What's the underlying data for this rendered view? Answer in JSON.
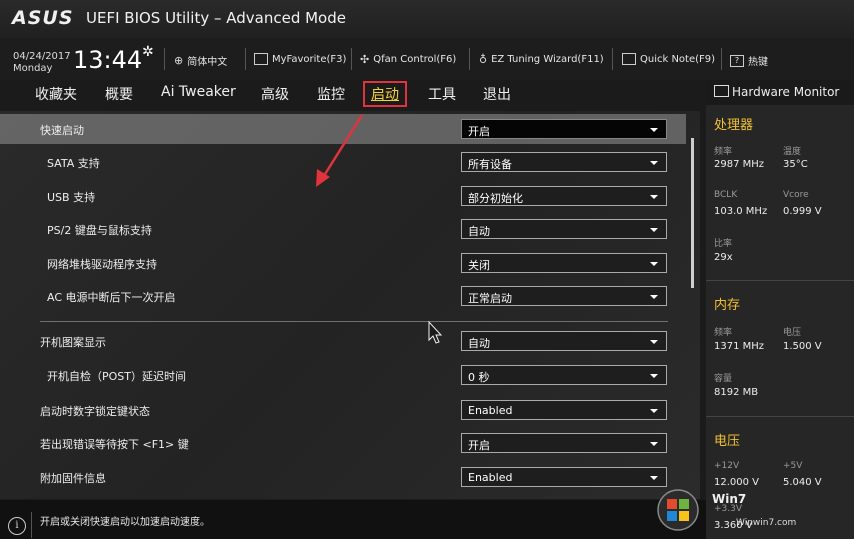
{
  "title_bar": {
    "brand": "ASUS",
    "title": "UEFI BIOS Utility – Advanced Mode"
  },
  "info_bar": {
    "date": "04/24/2017",
    "weekday": "Monday",
    "time": "13:44",
    "tools": [
      {
        "label": "简体中文",
        "icon": "globe-icon"
      },
      {
        "label": "MyFavorite(F3)",
        "icon": "favorite-icon"
      },
      {
        "label": "Qfan Control(F6)",
        "icon": "fan-icon"
      },
      {
        "label": "EZ Tuning Wizard(F11)",
        "icon": "bulb-icon"
      },
      {
        "label": "Quick Note(F9)",
        "icon": "note-icon"
      },
      {
        "label": "热键",
        "icon": "hotkey-icon"
      }
    ]
  },
  "tabs": [
    {
      "label": "收藏夹"
    },
    {
      "label": "概要"
    },
    {
      "label": "Ai Tweaker"
    },
    {
      "label": "高级"
    },
    {
      "label": "监控"
    },
    {
      "label": "启动",
      "active": true
    },
    {
      "label": "工具"
    },
    {
      "label": "退出"
    }
  ],
  "settings": [
    {
      "label": "快速启动",
      "value": "开启"
    },
    {
      "label": "SATA 支持",
      "value": "所有设备"
    },
    {
      "label": "USB 支持",
      "value": "部分初始化"
    },
    {
      "label": "PS/2 键盘与鼠标支持",
      "value": "自动"
    },
    {
      "label": "网络堆栈驱动程序支持",
      "value": "关闭"
    },
    {
      "label": "AC 电源中断后下一次开启",
      "value": "正常启动"
    },
    {
      "label": "开机图案显示",
      "value": "自动"
    },
    {
      "label": "开机自检（POST）延迟时间",
      "value": "0 秒"
    },
    {
      "label": "启动时数字锁定键状态",
      "value": "Enabled"
    },
    {
      "label": "若出现错误等待按下 <F1> 键",
      "value": "开启"
    },
    {
      "label": "附加固件信息",
      "value": "Enabled"
    }
  ],
  "help_text": "开启或关闭快速启动以加速启动速度。",
  "monitor": {
    "title": "Hardware Monitor",
    "cpu": {
      "title": "处理器",
      "freq_label": "频率",
      "freq": "2987 MHz",
      "temp_label": "温度",
      "temp": "35°C",
      "bclk_label": "BCLK",
      "bclk": "103.0 MHz",
      "vcore_label": "Vcore",
      "vcore": "0.999 V",
      "ratio_label": "比率",
      "ratio": "29x"
    },
    "memory": {
      "title": "内存",
      "freq_label": "频率",
      "freq": "1371 MHz",
      "volt_label": "电压",
      "volt": "1.500 V",
      "cap_label": "容量",
      "cap": "8192 MB"
    },
    "voltage": {
      "title": "电压",
      "v12_label": "+12V",
      "v12": "12.000 V",
      "v5_label": "+5V",
      "v5": "5.040 V",
      "v33_label": "+3.3V",
      "v33": "3.360 V"
    }
  },
  "watermark": {
    "brand": "Win7",
    "url": "Winwin7.com"
  },
  "colors": {
    "accent": "#f0c030",
    "active_tab": "#f4d23c",
    "annotation": "#e0333c"
  }
}
